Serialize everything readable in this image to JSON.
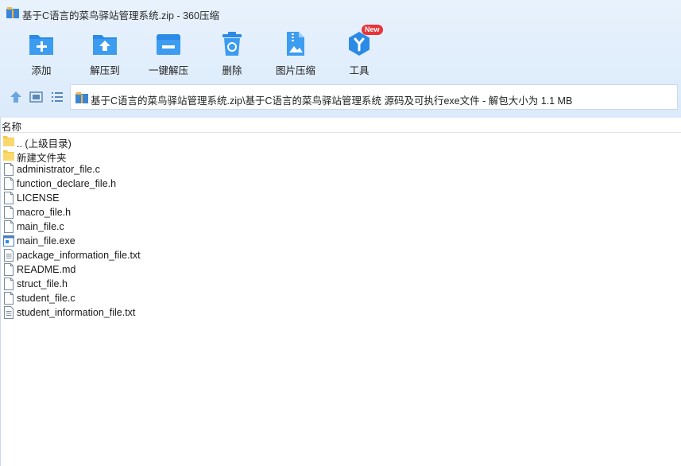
{
  "window": {
    "title": "基于C语言的菜鸟驿站管理系统.zip - 360压缩"
  },
  "toolbar": [
    {
      "label": "添加",
      "icon": "add-icon"
    },
    {
      "label": "解压到",
      "icon": "extract-to-icon"
    },
    {
      "label": "一键解压",
      "icon": "one-click-extract-icon"
    },
    {
      "label": "删除",
      "icon": "delete-icon"
    },
    {
      "label": "图片压缩",
      "icon": "image-compress-icon"
    },
    {
      "label": "工具",
      "icon": "tools-icon",
      "badge": "New"
    }
  ],
  "address": {
    "path": "基于C语言的菜鸟驿站管理系统.zip\\基于C语言的菜鸟驿站管理系统 源码及可执行exe文件 - 解包大小为 1.1 MB"
  },
  "list": {
    "header": "名称",
    "files": [
      {
        "name": ".. (上级目录)",
        "type": "folder"
      },
      {
        "name": "新建文件夹",
        "type": "folder"
      },
      {
        "name": "administrator_file.c",
        "type": "file"
      },
      {
        "name": "function_declare_file.h",
        "type": "file"
      },
      {
        "name": "LICENSE",
        "type": "file"
      },
      {
        "name": "macro_file.h",
        "type": "file"
      },
      {
        "name": "main_file.c",
        "type": "file"
      },
      {
        "name": "main_file.exe",
        "type": "exe"
      },
      {
        "name": "package_information_file.txt",
        "type": "text"
      },
      {
        "name": "README.md",
        "type": "file"
      },
      {
        "name": "struct_file.h",
        "type": "file"
      },
      {
        "name": "student_file.c",
        "type": "file"
      },
      {
        "name": "student_information_file.txt",
        "type": "text"
      }
    ]
  },
  "colors": {
    "accent": "#2a8ae6",
    "toolbar_bg": "#e3effc",
    "badge": "#e8343a",
    "folder": "#f6c94e"
  }
}
